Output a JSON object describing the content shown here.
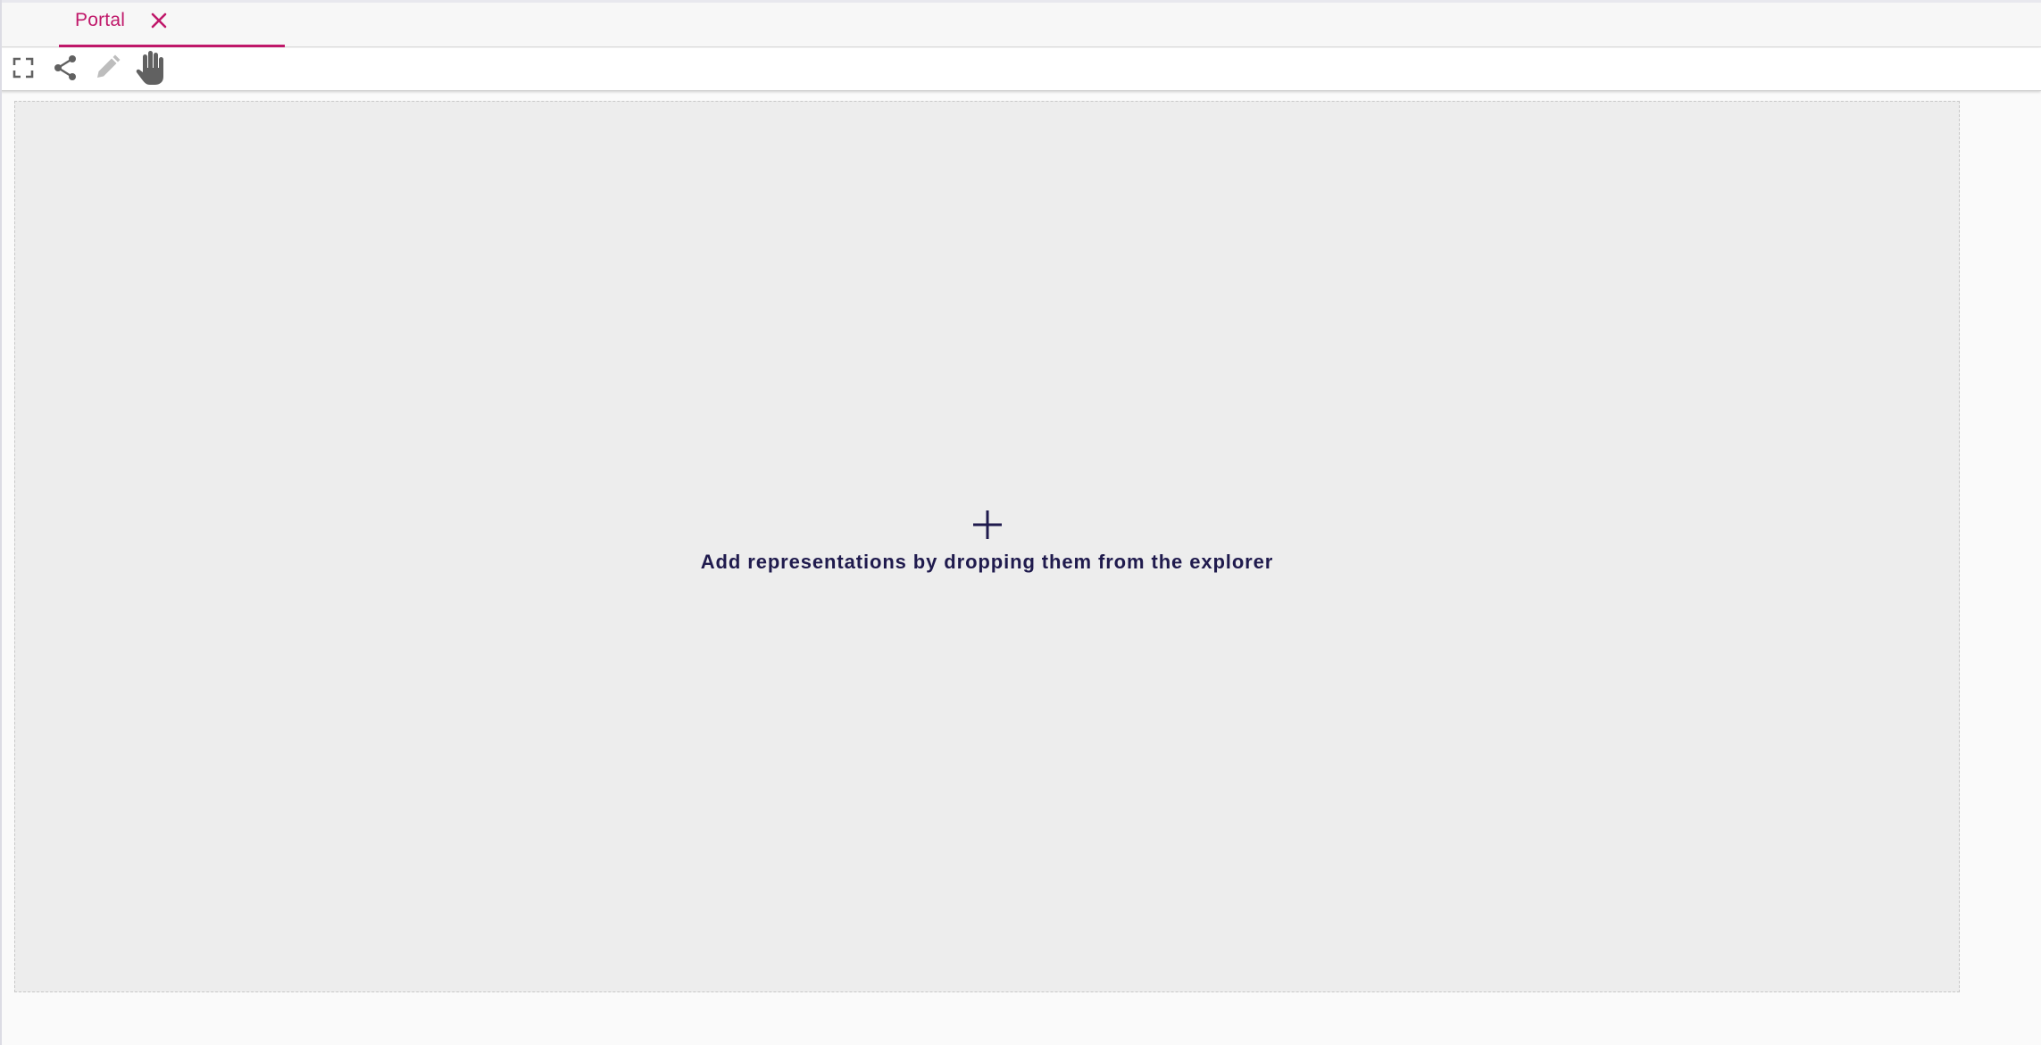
{
  "tabs": [
    {
      "label": "Portal",
      "active": true,
      "close_icon": "close-icon"
    }
  ],
  "toolbar": {
    "buttons": [
      {
        "name": "fullscreen",
        "icon": "fullscreen-icon",
        "enabled": true
      },
      {
        "name": "share",
        "icon": "share-icon",
        "enabled": true
      },
      {
        "name": "edit",
        "icon": "pencil-icon",
        "enabled": false
      },
      {
        "name": "pan",
        "icon": "hand-icon",
        "enabled": true
      }
    ]
  },
  "canvas": {
    "empty_icon": "plus-icon",
    "empty_message": "Add representations by dropping them from the explorer"
  },
  "colors": {
    "accent": "#c0186a",
    "text_dark": "#1f1a4d",
    "icon_gray": "#616161",
    "icon_disabled": "#bdbdbd",
    "canvas_bg": "#ededed"
  }
}
